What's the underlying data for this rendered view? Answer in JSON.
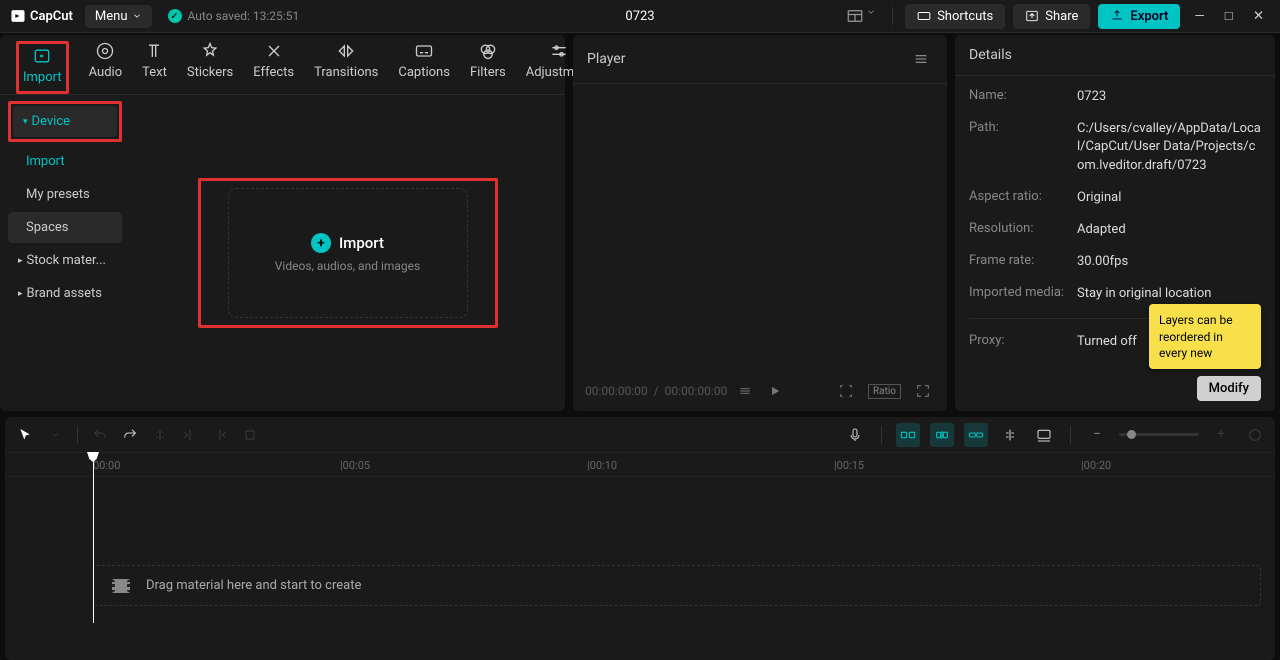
{
  "app": {
    "name": "CapCut",
    "project_title": "0723",
    "menu_label": "Menu",
    "autosave": "Auto saved: 13:25:51"
  },
  "topbar": {
    "shortcuts": "Shortcuts",
    "share": "Share",
    "export": "Export"
  },
  "tabs": [
    {
      "id": "import",
      "label": "Import"
    },
    {
      "id": "audio",
      "label": "Audio"
    },
    {
      "id": "text",
      "label": "Text"
    },
    {
      "id": "stickers",
      "label": "Stickers"
    },
    {
      "id": "effects",
      "label": "Effects"
    },
    {
      "id": "transitions",
      "label": "Transitions"
    },
    {
      "id": "captions",
      "label": "Captions"
    },
    {
      "id": "filters",
      "label": "Filters"
    },
    {
      "id": "adjustment",
      "label": "Adjustment"
    }
  ],
  "sidebar": {
    "device": "Device",
    "import": "Import",
    "presets": "My presets",
    "spaces": "Spaces",
    "stock": "Stock mater...",
    "brand": "Brand assets"
  },
  "dropzone": {
    "title": "Import",
    "subtitle": "Videos, audios, and images"
  },
  "player": {
    "title": "Player",
    "time_current": "00:00:00:00",
    "time_total": "00:00:00:00",
    "ratio_label": "Ratio"
  },
  "details": {
    "title": "Details",
    "rows": {
      "name_k": "Name:",
      "name_v": "0723",
      "path_k": "Path:",
      "path_v": "C:/Users/cvalley/AppData/Local/CapCut/User Data/Projects/com.lveditor.draft/0723",
      "aspect_k": "Aspect ratio:",
      "aspect_v": "Original",
      "res_k": "Resolution:",
      "res_v": "Adapted",
      "fps_k": "Frame rate:",
      "fps_v": "30.00fps",
      "imported_k": "Imported media:",
      "imported_v": "Stay in original location",
      "proxy_k": "Proxy:",
      "proxy_v": "Turned off"
    },
    "tooltip": "Layers can be reordered in every new",
    "modify": "Modify"
  },
  "timeline": {
    "ticks": [
      "00:00",
      "|00:05",
      "|00:10",
      "|00:15",
      "|00:20"
    ],
    "drop_hint": "Drag material here and start to create"
  }
}
